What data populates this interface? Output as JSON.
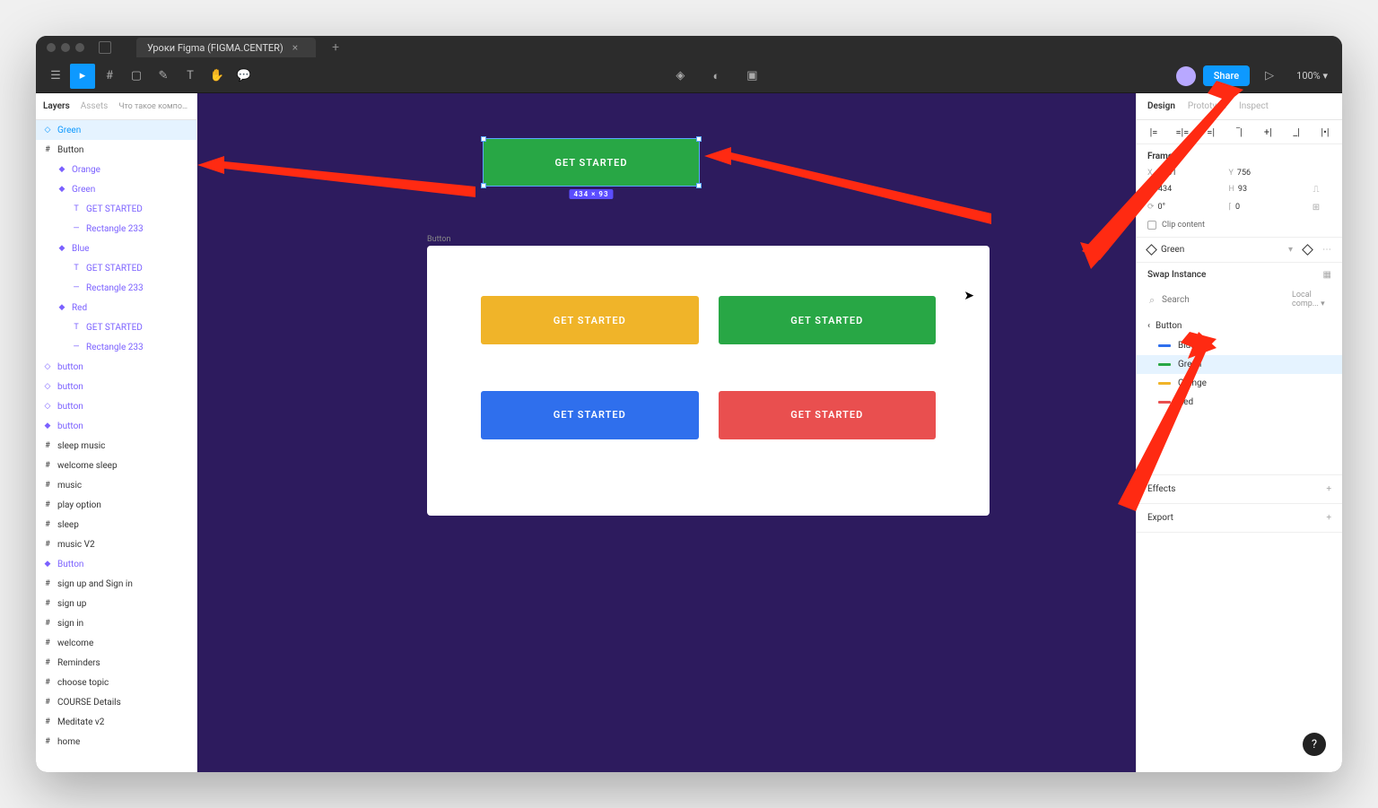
{
  "tab_title": "Уроки Figma (FIGMA.CENTER)",
  "toolbar": {
    "share": "Share",
    "zoom": "100%"
  },
  "left_panel": {
    "tabs": {
      "layers": "Layers",
      "assets": "Assets"
    },
    "page": "Что такое компоненты, как с...",
    "layers": [
      {
        "name": "Green",
        "icon": "◇",
        "indent": 0,
        "selected": true,
        "purple": false
      },
      {
        "name": "Button",
        "icon": "#",
        "indent": 0
      },
      {
        "name": "Orange",
        "icon": "◆",
        "indent": 1,
        "purple": true
      },
      {
        "name": "Green",
        "icon": "◆",
        "indent": 1,
        "purple": true
      },
      {
        "name": "GET STARTED",
        "icon": "T",
        "indent": 2,
        "purple": true
      },
      {
        "name": "Rectangle 233",
        "icon": "—",
        "indent": 2,
        "purple": true
      },
      {
        "name": "Blue",
        "icon": "◆",
        "indent": 1,
        "purple": true
      },
      {
        "name": "GET STARTED",
        "icon": "T",
        "indent": 2,
        "purple": true
      },
      {
        "name": "Rectangle 233",
        "icon": "—",
        "indent": 2,
        "purple": true
      },
      {
        "name": "Red",
        "icon": "◆",
        "indent": 1,
        "purple": true
      },
      {
        "name": "GET STARTED",
        "icon": "T",
        "indent": 2,
        "purple": true
      },
      {
        "name": "Rectangle 233",
        "icon": "—",
        "indent": 2,
        "purple": true
      },
      {
        "name": "button",
        "icon": "◇",
        "indent": 0,
        "purple": true
      },
      {
        "name": "button",
        "icon": "◇",
        "indent": 0,
        "purple": true
      },
      {
        "name": "button",
        "icon": "◇",
        "indent": 0,
        "purple": true
      },
      {
        "name": "button",
        "icon": "◆",
        "indent": 0,
        "purple": true
      },
      {
        "name": "sleep music",
        "icon": "#",
        "indent": 0
      },
      {
        "name": "welcome sleep",
        "icon": "#",
        "indent": 0
      },
      {
        "name": "music",
        "icon": "#",
        "indent": 0
      },
      {
        "name": "play option",
        "icon": "#",
        "indent": 0
      },
      {
        "name": "sleep",
        "icon": "#",
        "indent": 0
      },
      {
        "name": "music V2",
        "icon": "#",
        "indent": 0
      },
      {
        "name": "Button",
        "icon": "◆",
        "indent": 0,
        "purple": true
      },
      {
        "name": "sign up and Sign in",
        "icon": "#",
        "indent": 0
      },
      {
        "name": "sign up",
        "icon": "#",
        "indent": 0
      },
      {
        "name": "sign in",
        "icon": "#",
        "indent": 0
      },
      {
        "name": "welcome",
        "icon": "#",
        "indent": 0
      },
      {
        "name": "Reminders",
        "icon": "#",
        "indent": 0
      },
      {
        "name": "choose topic",
        "icon": "#",
        "indent": 0
      },
      {
        "name": "COURSE Details",
        "icon": "#",
        "indent": 0
      },
      {
        "name": "Meditate v2",
        "icon": "#",
        "indent": 0
      },
      {
        "name": "home",
        "icon": "#",
        "indent": 0
      }
    ]
  },
  "canvas": {
    "selected_label": "GET STARTED",
    "dim_badge": "434 × 93",
    "frame_label": "Button",
    "buttons": {
      "orange": "GET STARTED",
      "green": "GET STARTED",
      "blue": "GET STARTED",
      "red": "GET STARTED"
    }
  },
  "right_panel": {
    "tabs": {
      "design": "Design",
      "prototype": "Prototype",
      "inspect": "Inspect"
    },
    "frame_title": "Frame",
    "x": "-6941",
    "y": "756",
    "w": "434",
    "h": "93",
    "rot": "0°",
    "rad": "0",
    "clip": "Clip content",
    "instance_name": "Green",
    "swap_title": "Swap Instance",
    "search_placeholder": "Search",
    "local": "Local comp...",
    "back": "Button",
    "options": [
      {
        "name": "Blue",
        "cls": "sw-blue"
      },
      {
        "name": "Green",
        "cls": "sw-green",
        "sel": true
      },
      {
        "name": "Orange",
        "cls": "sw-orange"
      },
      {
        "name": "Red",
        "cls": "sw-red"
      }
    ],
    "effects": "Effects",
    "export": "Export"
  }
}
